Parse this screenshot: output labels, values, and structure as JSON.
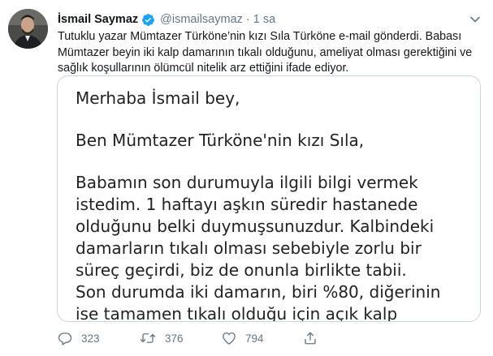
{
  "author": {
    "name": "İsmail Saymaz",
    "handle": "@ismailsaymaz",
    "time": "1 sa",
    "separator": "·"
  },
  "tweet_text": "Tutuklu yazar Mümtazer Türköne’nin kızı Sıla Türköne e-mail gönderdi. Babası Mümtazer beyin iki kalp damarının tıkalı olduğunu, ameliyat olması gerektiğini ve sağlık koşullarının ölümcül nitelik arz ettiğini ifade ediyor.",
  "media": {
    "greeting": "Merhaba İsmail bey,",
    "intro": "Ben Mümtazer Türköne'nin kızı Sıla,",
    "lines": [
      "Babamın son durumuyla ilgili bilgi vermek",
      "istedim. 1 haftayı aşkın süredir hastanede",
      "olduğunu belki duymuşsunuzdur. Kalbindeki",
      "damarların tıkalı olması sebebiyle zorlu bir",
      "süreç geçirdi, biz de onunla birlikte tabii.",
      "Son durumda iki damarın, biri %80, diğerinin",
      "ise tamamen tıkalı olduğu için açık kalp"
    ]
  },
  "actions": {
    "replies": "323",
    "retweets": "376",
    "likes": "794"
  },
  "colors": {
    "verified": "#1da1f2",
    "secondary_text": "#657786",
    "border": "#ccd6dd"
  },
  "icons": [
    "verified-badge-icon",
    "chevron-down-icon",
    "reply-icon",
    "retweet-icon",
    "like-icon",
    "share-icon"
  ]
}
